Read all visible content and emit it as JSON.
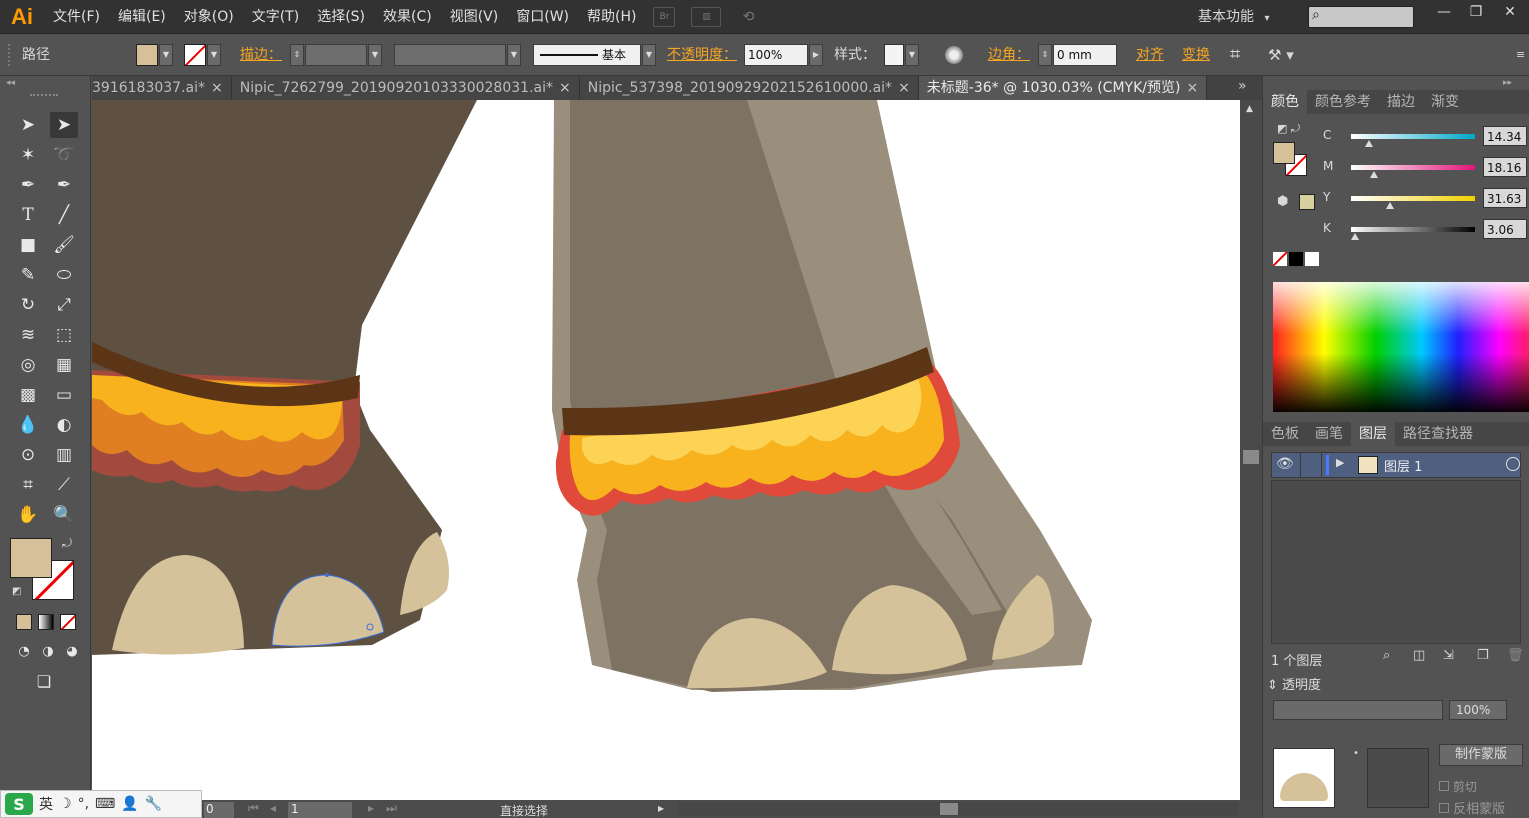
{
  "app": {
    "logo": "Ai",
    "menus": [
      "文件(F)",
      "编辑(E)",
      "对象(O)",
      "文字(T)",
      "选择(S)",
      "效果(C)",
      "视图(V)",
      "窗口(W)",
      "帮助(H)"
    ],
    "bridge_badge": "Br",
    "workspace": "基本功能",
    "workspace_arrow": "▾",
    "search_icon": "⌕",
    "window_buttons": {
      "minimize": "—",
      "restore": "❐",
      "close": "✕"
    }
  },
  "control_bar": {
    "object_type": "路径",
    "stroke_label": "描边：",
    "stroke_style": "基本",
    "opacity_label": "不透明度：",
    "opacity_value": "100%",
    "style_label": "样式：",
    "corner_label": "边角：",
    "corner_value": "0 mm",
    "align_label": "对齐",
    "transform_label": "变换",
    "fill_color": "#d5c09a"
  },
  "tabs": [
    {
      "label": "3916183037.ai*",
      "close": "×",
      "active": false
    },
    {
      "label": "Nipic_7262799_20190920103330028031.ai*",
      "close": "×",
      "active": false
    },
    {
      "label": "Nipic_537398_20190929202152610000.ai*",
      "close": "×",
      "active": false
    },
    {
      "label": "未标题-36* @ 1030.03% (CMYK/预览)",
      "close": "×",
      "active": true
    }
  ],
  "tab_overflow": "»",
  "tools": {
    "type_tool_glyph": "T"
  },
  "color_panel": {
    "tabs": [
      "颜色",
      "颜色参考",
      "描边",
      "渐变"
    ],
    "channels": [
      {
        "label": "C",
        "value": "14.34",
        "fraction": 0.1434,
        "gradient": [
          "#ffffff",
          "#00a8c8"
        ]
      },
      {
        "label": "M",
        "value": "18.16",
        "fraction": 0.1816,
        "gradient": [
          "#ffffff",
          "#e0157a"
        ]
      },
      {
        "label": "Y",
        "value": "31.63",
        "fraction": 0.3163,
        "gradient": [
          "#ffffff",
          "#f0d000"
        ]
      },
      {
        "label": "K",
        "value": "3.06",
        "fraction": 0.0306,
        "gradient": [
          "#ffffff",
          "#000000"
        ]
      }
    ],
    "current_fill": "#d5c09a"
  },
  "layers_panel": {
    "tabs": [
      "色板",
      "画笔",
      "图层",
      "路径查找器"
    ],
    "layer_name": "图层 1",
    "layer_count": "1 个图层"
  },
  "transparency_panel": {
    "title": "透明度",
    "opacity": "100%",
    "make_mask": "制作蒙版",
    "clip": "剪切",
    "invert_mask": "反相蒙版"
  },
  "status_bar": {
    "zoom_field": "0",
    "page_field": "1",
    "tool_name": "直接选择"
  },
  "ime": {
    "logo": "S",
    "mode": "英"
  },
  "colors": {
    "accent_orange": "#f5a623",
    "elephant_dark": "#5e5142",
    "elephant_mid": "#7e7262",
    "elephant_light": "#9a8e7c",
    "nail": "#d5c19a",
    "band_brown": "#5c3416",
    "ruffle_yellow": "#f7b21d",
    "ruffle_light": "#fdd355",
    "ruffle_red": "#e04a3a"
  }
}
